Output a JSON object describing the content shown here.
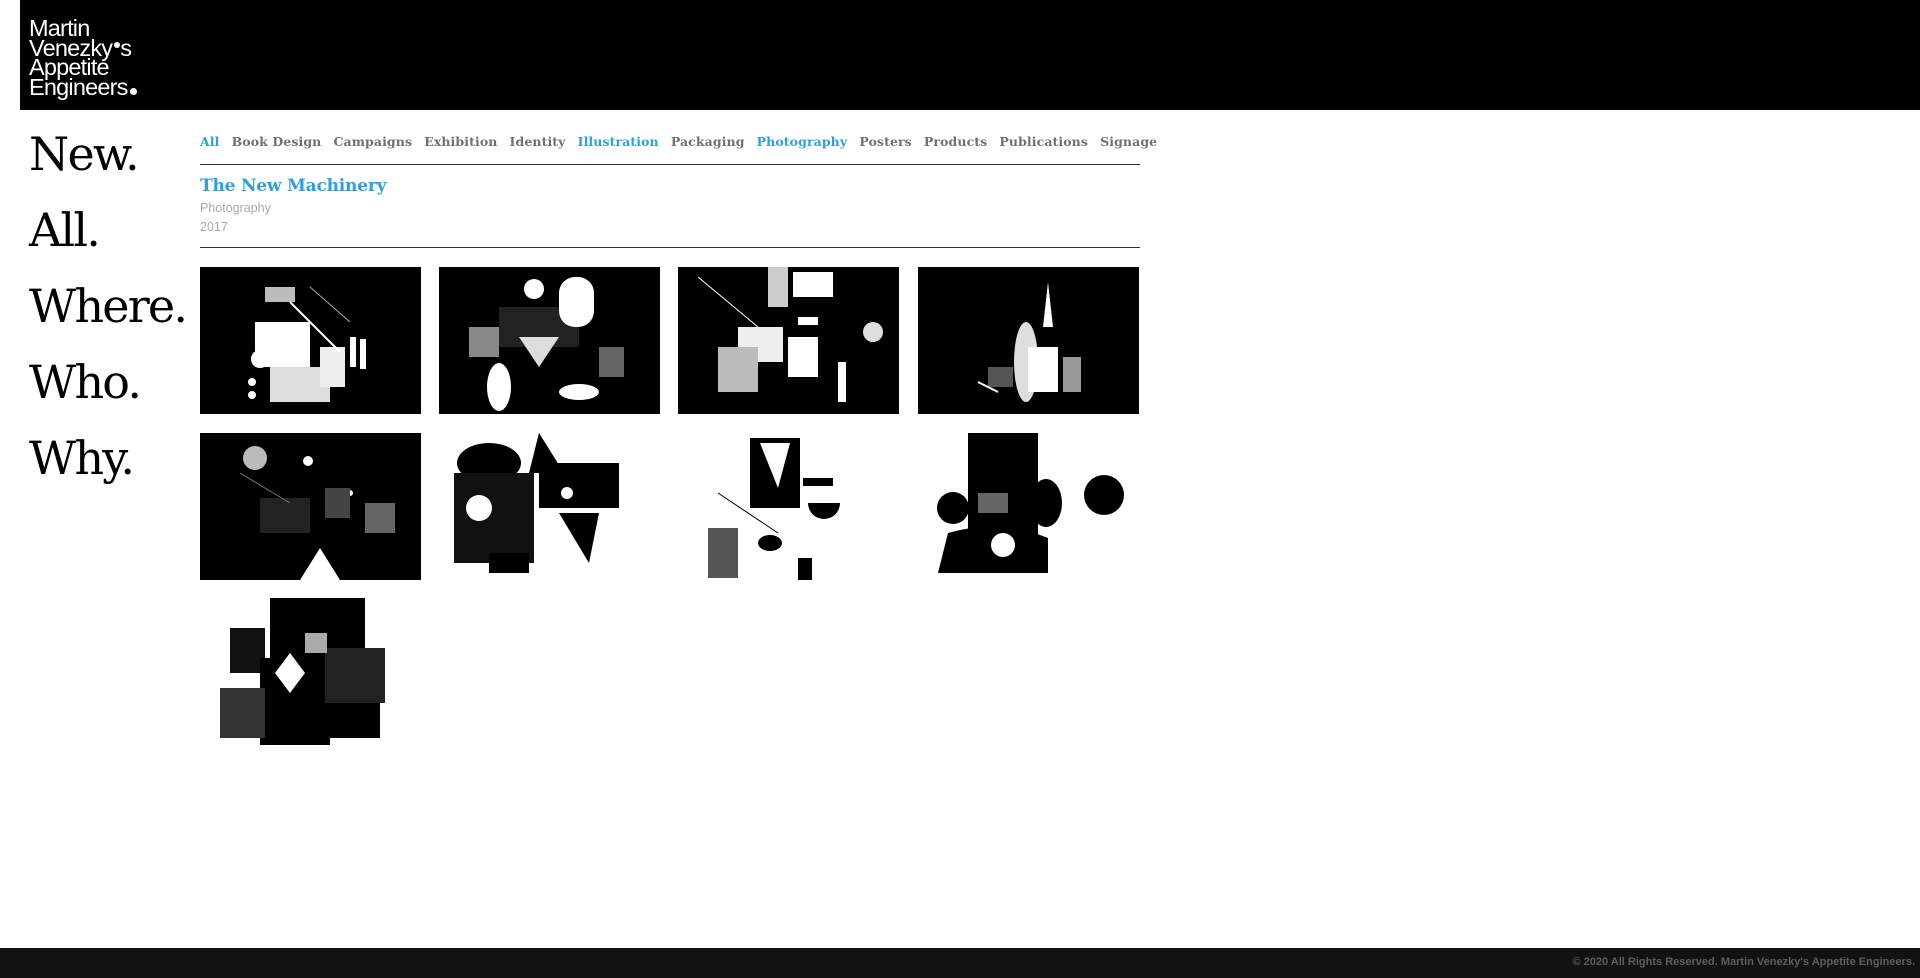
{
  "logo": {
    "line1": "Martin",
    "line2": "Venezky",
    "line2_suffix": "s",
    "line3": "Appetite",
    "line4": "Engineers"
  },
  "side_nav": [
    "New.",
    "All.",
    "Where.",
    "Who.",
    "Why."
  ],
  "filters": [
    {
      "label": "All",
      "active": true
    },
    {
      "label": "Book Design",
      "active": false
    },
    {
      "label": "Campaigns",
      "active": false
    },
    {
      "label": "Exhibition",
      "active": false
    },
    {
      "label": "Identity",
      "active": false
    },
    {
      "label": "Illustration",
      "active": true
    },
    {
      "label": "Packaging",
      "active": false
    },
    {
      "label": "Photography",
      "active": true
    },
    {
      "label": "Posters",
      "active": false
    },
    {
      "label": "Products",
      "active": false
    },
    {
      "label": "Publications",
      "active": false
    },
    {
      "label": "Signage",
      "active": false
    }
  ],
  "project": {
    "title": "The New Machinery",
    "category": "Photography",
    "year": "2017"
  },
  "gallery": {
    "count": 9,
    "backgrounds": [
      "dark",
      "dark",
      "dark",
      "dark",
      "dark",
      "light",
      "light",
      "light",
      "light"
    ]
  },
  "footer": {
    "copyright": "© 2020 All Rights Reserved. Martin Venezky's Appetite Engineers."
  },
  "colors": {
    "accent": "#2d9fe0",
    "filter_text": "#707070",
    "meta_text": "#a8a8a8",
    "header_bg": "#000000",
    "footer_bg": "#121212"
  }
}
